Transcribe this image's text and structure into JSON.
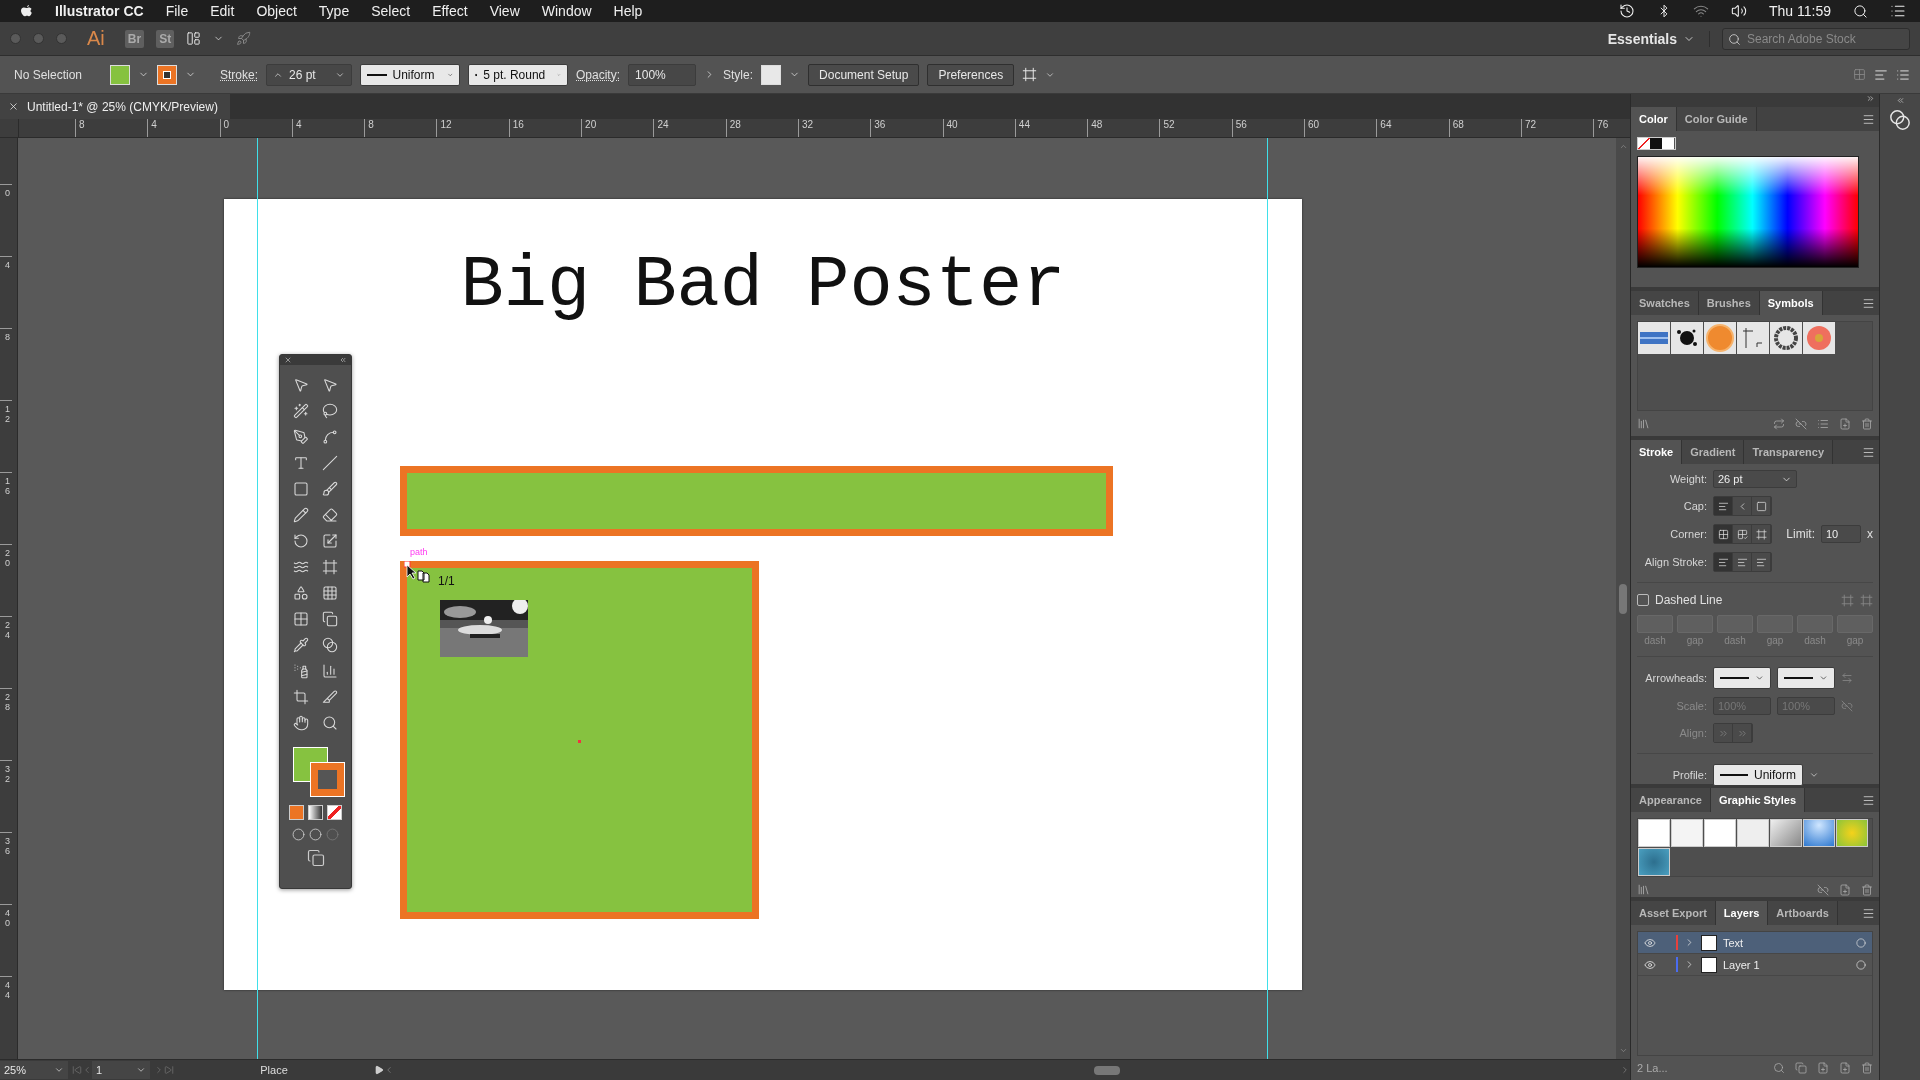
{
  "menu_bar": {
    "app": "Illustrator CC",
    "items": [
      "File",
      "Edit",
      "Object",
      "Type",
      "Select",
      "Effect",
      "View",
      "Window",
      "Help"
    ],
    "clock": "Thu 11:59"
  },
  "app_bar": {
    "logo": "Ai",
    "bridge": "Br",
    "stock": "St",
    "workspace": "Essentials",
    "search": {
      "placeholder": "Search Adobe Stock"
    }
  },
  "control_bar": {
    "selection": "No Selection",
    "stroke_label": "Stroke:",
    "stroke_weight": "26 pt",
    "profile": "Uniform",
    "brush": "5 pt. Round",
    "opacity_label": "Opacity:",
    "opacity": "100%",
    "style_label": "Style:",
    "buttons": [
      "Document Setup",
      "Preferences"
    ]
  },
  "document_tab": {
    "title": "Untitled-1* @ 25% (CMYK/Preview)"
  },
  "rulers": {
    "horizontal": [
      "8",
      "4",
      "0",
      "4",
      "8",
      "12",
      "16",
      "20",
      "24",
      "28",
      "32",
      "36",
      "40",
      "44",
      "48",
      "52",
      "56",
      "60",
      "64",
      "68",
      "72",
      "76"
    ],
    "vertical": [
      "0",
      "4",
      "8",
      "12",
      "16",
      "20",
      "24",
      "28",
      "32",
      "36",
      "40",
      "44"
    ]
  },
  "artboard": {
    "title": "Big Bad Poster",
    "place": {
      "label": "path",
      "count": "1/1"
    }
  },
  "panels": [
    {
      "kind": "color",
      "tabs": [
        {
          "label": "Color",
          "selected": true
        },
        {
          "label": "Color Guide",
          "selected": false
        }
      ]
    },
    {
      "kind": "symbols",
      "tabs": [
        {
          "label": "Swatches",
          "selected": false
        },
        {
          "label": "Brushes",
          "selected": false
        },
        {
          "label": "Symbols",
          "selected": true
        }
      ]
    },
    {
      "kind": "stroke",
      "tabs": [
        {
          "label": "Stroke",
          "selected": true
        },
        {
          "label": "Gradient",
          "selected": false
        },
        {
          "label": "Transparency",
          "selected": false
        }
      ],
      "weight_label": "Weight:",
      "weight": "26 pt",
      "cap_label": "Cap:",
      "corner_label": "Corner:",
      "limit_label": "Limit:",
      "limit": "10",
      "limit_unit": "x",
      "align_label": "Align Stroke:",
      "dashed": {
        "label": "Dashed Line",
        "checked": false
      },
      "dash_labels": [
        "dash",
        "gap",
        "dash",
        "gap",
        "dash",
        "gap"
      ],
      "arrowheads_label": "Arrowheads:",
      "scale_label": "Scale:",
      "scales": [
        "100%",
        "100%"
      ],
      "arrow_align_label": "Align:",
      "profile_label": "Profile:",
      "profile": "Uniform"
    },
    {
      "kind": "graphic_styles",
      "tabs": [
        {
          "label": "Appearance",
          "selected": false
        },
        {
          "label": "Graphic Styles",
          "selected": true
        }
      ]
    },
    {
      "kind": "layers",
      "tabs": [
        {
          "label": "Asset Export",
          "selected": false
        },
        {
          "label": "Layers",
          "selected": true
        },
        {
          "label": "Artboards",
          "selected": false
        }
      ],
      "layers": [
        {
          "name": "Text",
          "selected": true,
          "color": "#e8413c"
        },
        {
          "name": "Layer 1",
          "selected": false,
          "color": "#4a6cf0"
        }
      ],
      "footer": "2 La..."
    }
  ],
  "status_bar": {
    "zoom": "25%",
    "artboard": "1",
    "status": "Place"
  }
}
